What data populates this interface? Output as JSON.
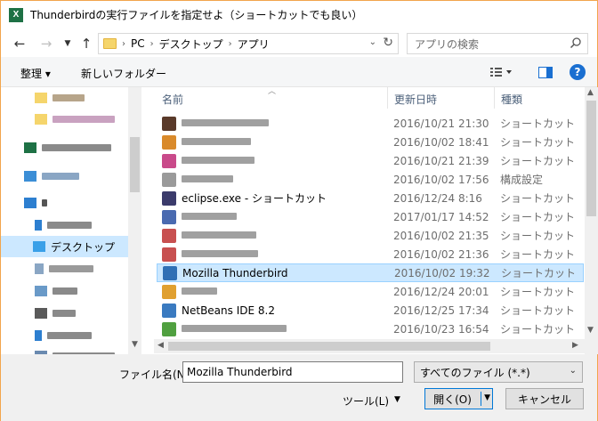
{
  "window": {
    "title": "Thunderbirdの実行ファイルを指定せよ（ショートカットでも良い）",
    "app_icon_letter": "X"
  },
  "nav": {
    "breadcrumb": [
      "PC",
      "デスクトップ",
      "アプリ"
    ],
    "search_placeholder": "アプリの検索"
  },
  "toolbar": {
    "organize_label": "整理 ▾",
    "new_folder_label": "新しいフォルダー",
    "help_label": "?"
  },
  "sidebar": {
    "selected_label": "デスクトップ"
  },
  "columns": {
    "name": "名前",
    "date": "更新日時",
    "type": "種類"
  },
  "files": [
    {
      "name": "",
      "date": "2016/10/21 21:30",
      "type": "ショートカット",
      "color": "#5a3a2a"
    },
    {
      "name": "",
      "date": "2016/10/02 18:41",
      "type": "ショートカット",
      "color": "#d98a2b"
    },
    {
      "name": "",
      "date": "2016/10/21 21:39",
      "type": "ショートカット",
      "color": "#c94a8a"
    },
    {
      "name": "",
      "date": "2016/10/02 17:56",
      "type": "構成設定",
      "color": "#9a9a9a"
    },
    {
      "name": "eclipse.exe - ショートカット",
      "date": "2016/12/24 8:16",
      "type": "ショートカット",
      "color": "#3b3b6b"
    },
    {
      "name": "",
      "date": "2017/01/17 14:52",
      "type": "ショートカット",
      "color": "#4a6ab0"
    },
    {
      "name": "",
      "date": "2016/10/02 21:35",
      "type": "ショートカット",
      "color": "#c85050"
    },
    {
      "name": "",
      "date": "2016/10/02 21:36",
      "type": "ショートカット",
      "color": "#c85050"
    },
    {
      "name": "Mozilla Thunderbird",
      "date": "2016/10/02 19:32",
      "type": "ショートカット",
      "color": "#2f6fb5"
    },
    {
      "name": "",
      "date": "2016/12/24 20:01",
      "type": "ショートカット",
      "color": "#e0a030"
    },
    {
      "name": "NetBeans IDE 8.2",
      "date": "2016/12/25 17:34",
      "type": "ショートカット",
      "color": "#3a7ac0"
    },
    {
      "name": "",
      "date": "2016/10/23 16:54",
      "type": "ショートカット",
      "color": "#50a040"
    }
  ],
  "bottom": {
    "filename_label": "ファイル名(N):",
    "filename_value": "Mozilla Thunderbird",
    "filter_value": "すべてのファイル (*.*)",
    "tools_label": "ツール(L)",
    "open_label": "開く(O)",
    "cancel_label": "キャンセル"
  },
  "colors": {
    "selection": "#cce8ff",
    "accent": "#0078d7",
    "window_border": "#f2a54c"
  }
}
